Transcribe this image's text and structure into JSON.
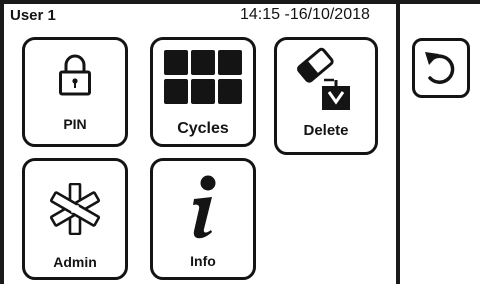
{
  "header": {
    "user": "User 1",
    "datetime": "14:15 -16/10/2018"
  },
  "tiles": [
    {
      "label": "PIN",
      "icon": "padlock-icon"
    },
    {
      "label": "Cycles",
      "icon": "grid-icon"
    },
    {
      "label": "Delete",
      "icon": "eraser-icon"
    },
    {
      "label": "Admin",
      "icon": "asterisk-icon"
    },
    {
      "label": "Info",
      "icon": "info-icon"
    }
  ],
  "back_button": {
    "icon": "back-arrow-icon"
  },
  "colors": {
    "foreground": "#141414",
    "background": "#ffffff"
  }
}
